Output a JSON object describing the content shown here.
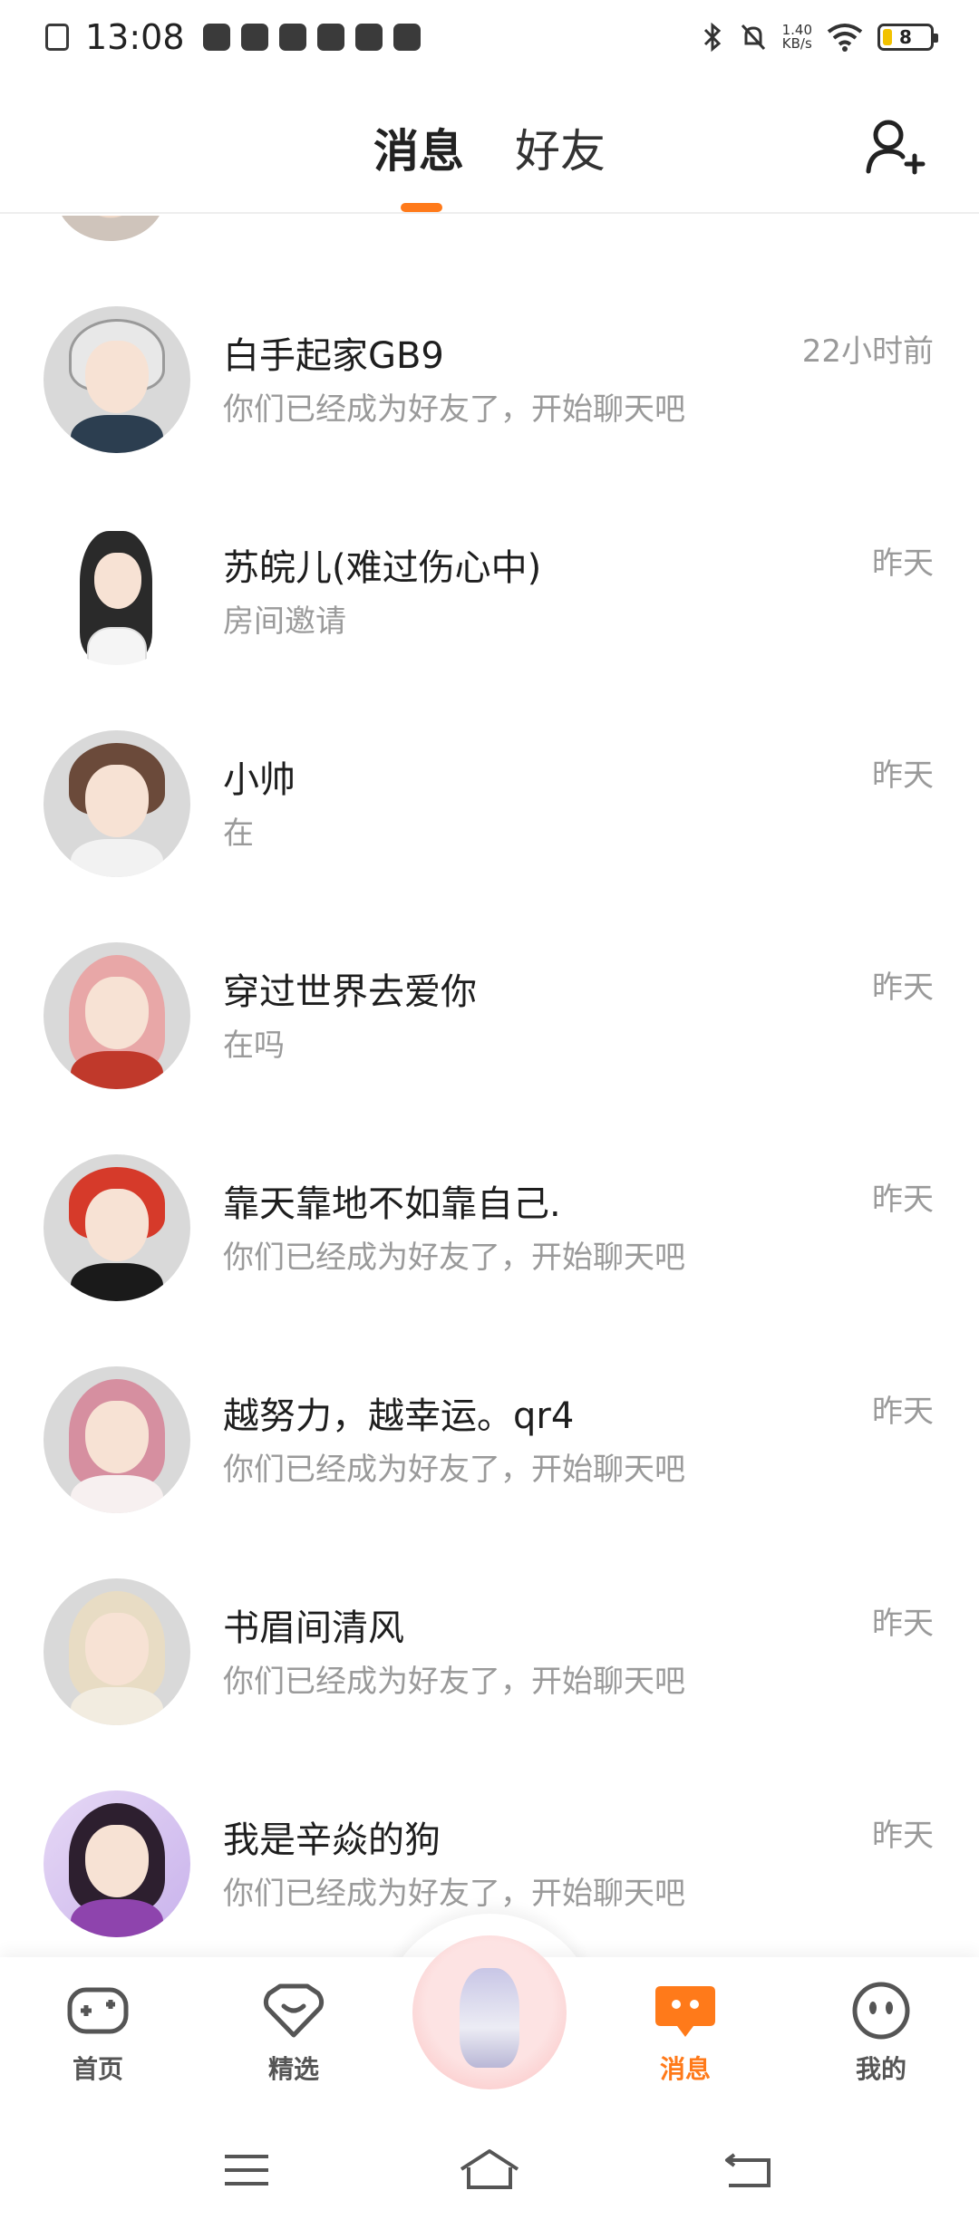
{
  "status_bar": {
    "time": "13:08",
    "net_speed_value": "1.40",
    "net_speed_unit": "KB/s",
    "battery_level": "8"
  },
  "header": {
    "tab_messages": "消息",
    "tab_friends": "好友"
  },
  "conversations": [
    {
      "name": "白手起家GB9",
      "preview": "你们已经成为好友了，开始聊天吧",
      "time": "22小时前"
    },
    {
      "name": "苏皖儿(难过伤心中)",
      "preview": "房间邀请",
      "time": "昨天"
    },
    {
      "name": "小帅",
      "preview": "在",
      "time": "昨天"
    },
    {
      "name": "穿过世界去爱你",
      "preview": "在吗",
      "time": "昨天"
    },
    {
      "name": "靠天靠地不如靠自己.",
      "preview": "你们已经成为好友了，开始聊天吧",
      "time": "昨天"
    },
    {
      "name": "越努力，越幸运。qr4",
      "preview": "你们已经成为好友了，开始聊天吧",
      "time": "昨天"
    },
    {
      "name": "书眉间清风",
      "preview": "你们已经成为好友了，开始聊天吧",
      "time": "昨天"
    },
    {
      "name": "我是辛焱的狗",
      "preview": "你们已经成为好友了，开始聊天吧",
      "time": "昨天"
    }
  ],
  "bottom_nav": {
    "home": "首页",
    "featured": "精选",
    "messages": "消息",
    "mine": "我的"
  },
  "colors": {
    "accent": "#ff7a1a",
    "text_primary": "#1e1e1e",
    "text_secondary": "#9a9a9a"
  }
}
